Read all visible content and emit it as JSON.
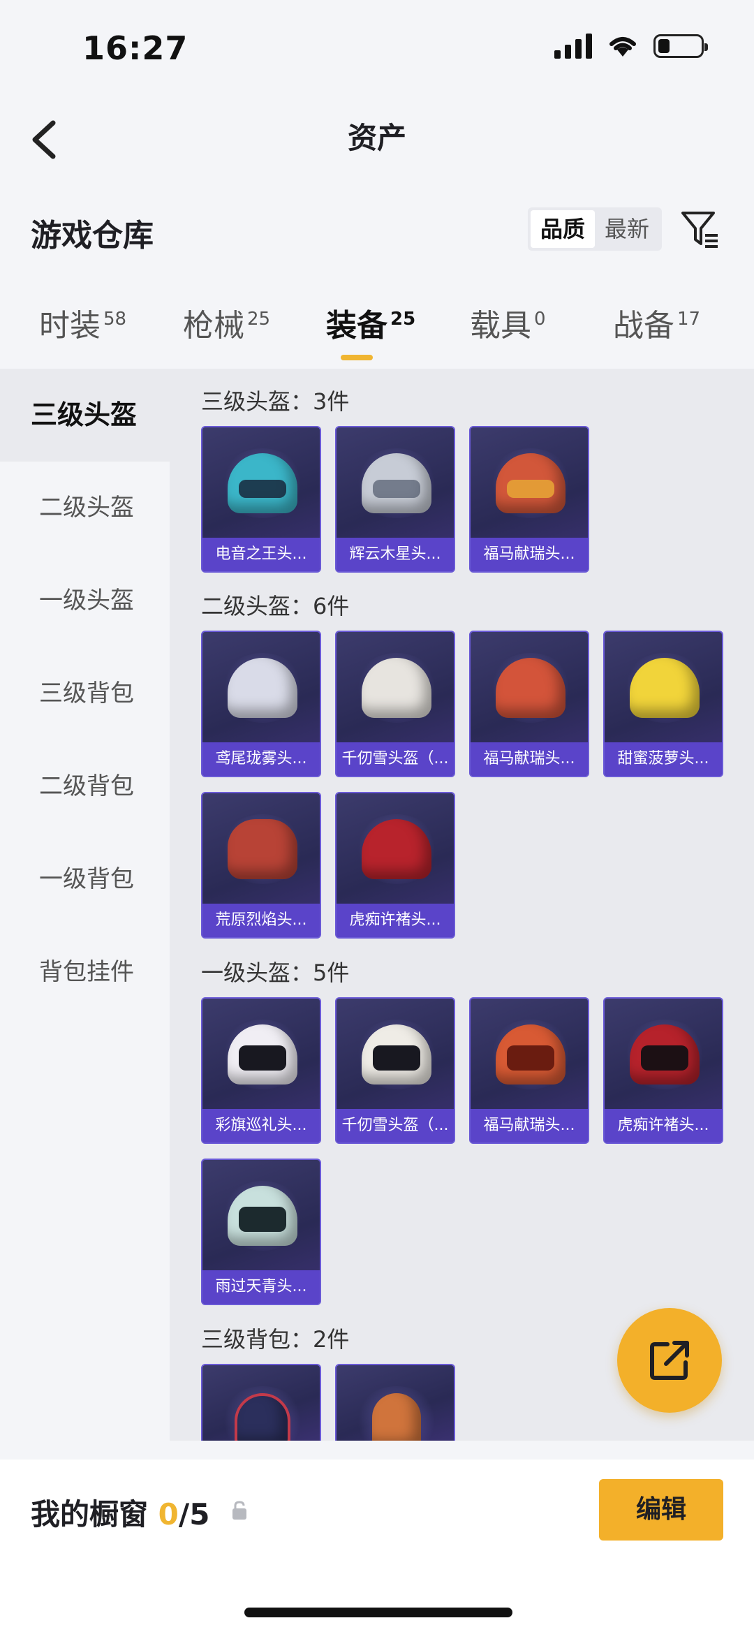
{
  "status": {
    "time": "16:27"
  },
  "nav": {
    "title": "资产"
  },
  "header": {
    "title": "游戏仓库",
    "sort": {
      "quality": "品质",
      "newest": "最新"
    }
  },
  "tabs": [
    {
      "label": "时装",
      "count": "58"
    },
    {
      "label": "枪械",
      "count": "25"
    },
    {
      "label": "装备",
      "count": "25"
    },
    {
      "label": "载具",
      "count": "0"
    },
    {
      "label": "战备",
      "count": "17"
    }
  ],
  "sidebar": [
    {
      "label": "三级头盔"
    },
    {
      "label": "二级头盔"
    },
    {
      "label": "一级头盔"
    },
    {
      "label": "三级背包"
    },
    {
      "label": "二级背包"
    },
    {
      "label": "一级背包"
    },
    {
      "label": "背包挂件"
    }
  ],
  "sections": [
    {
      "title": "三级头盔：3件",
      "items": [
        "电音之王头...",
        "辉云木星头...",
        "福马献瑞头..."
      ]
    },
    {
      "title": "二级头盔：6件",
      "items": [
        "鸢尾珑雾头...",
        "千仞雪头盔（...",
        "福马献瑞头...",
        "甜蜜菠萝头...",
        "荒原烈焰头...",
        "虎痴许褚头..."
      ]
    },
    {
      "title": "一级头盔：5件",
      "items": [
        "彩旗巡礼头...",
        "千仞雪头盔（...",
        "福马献瑞头...",
        "虎痴许褚头...",
        "雨过天青头..."
      ]
    },
    {
      "title": "三级背包：2件",
      "items": [
        "",
        ""
      ]
    }
  ],
  "bottom": {
    "label": "我的橱窗",
    "count": "0",
    "total": "/5",
    "edit": "编辑"
  },
  "colors": {
    "accent": "#f0b531",
    "card_label": "#5a44c9"
  }
}
